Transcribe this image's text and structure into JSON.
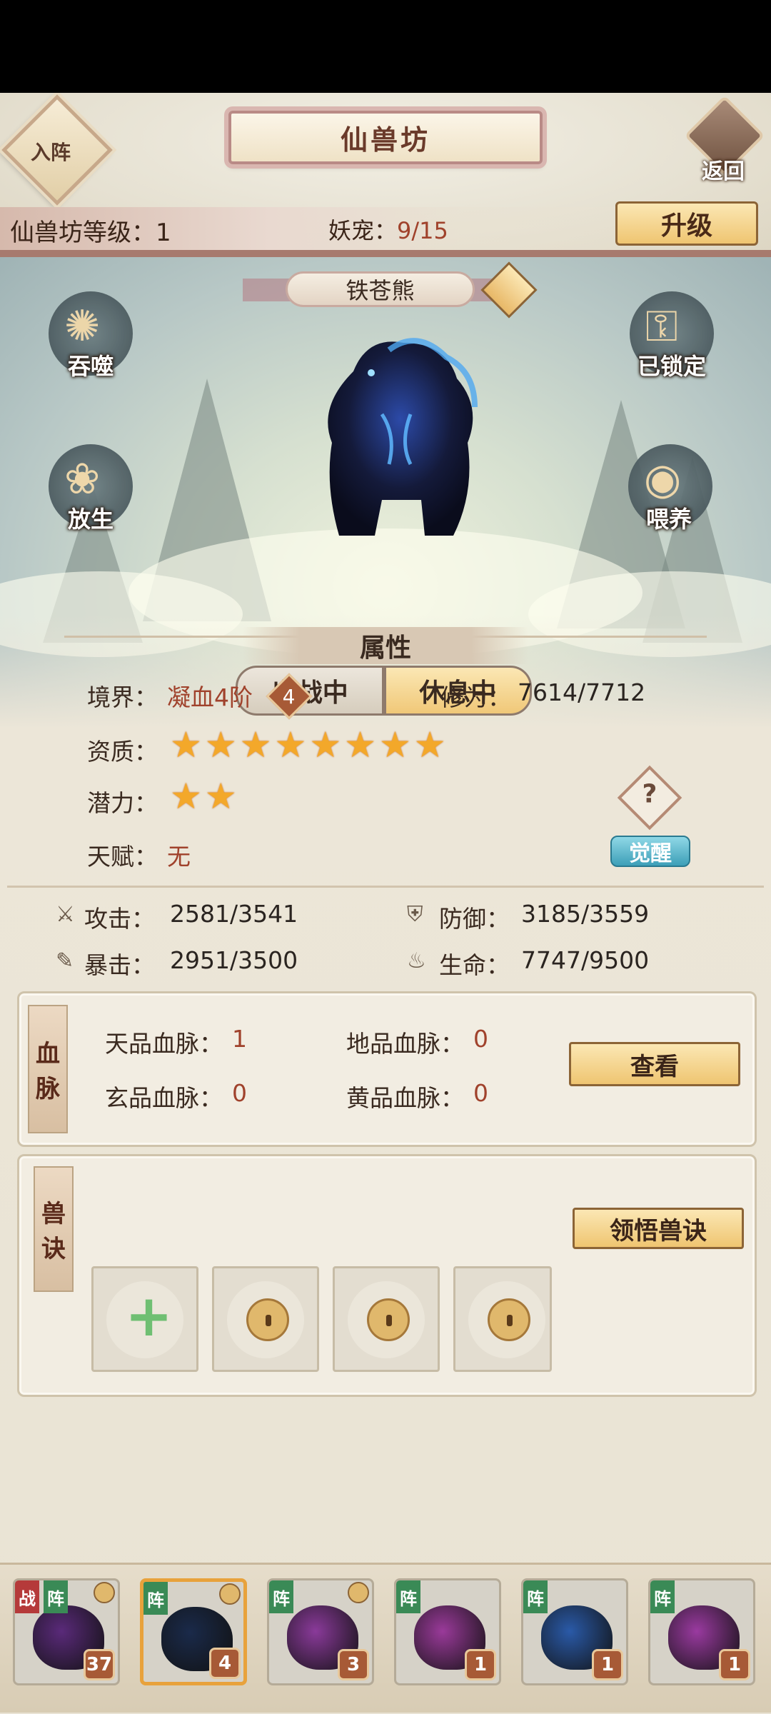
{
  "header": {
    "formation_label": "入阵",
    "title": "仙兽坊",
    "back_label": "返回",
    "level_label": "仙兽坊等级：",
    "level_value": "1",
    "pets_label": "妖宠：",
    "pets_value": "9/15",
    "upgrade_label": "升级"
  },
  "pet": {
    "name": "铁苍熊",
    "actions": {
      "devour": "吞噬",
      "locked": "已锁定",
      "release": "放生",
      "feed": "喂养"
    },
    "toggle": {
      "battle": "出战中",
      "rest": "休息中",
      "active": "rest"
    }
  },
  "attributes": {
    "section_title": "属性",
    "realm_label": "境界：",
    "realm_value": "凝血4阶",
    "realm_badge": "4",
    "cultivation_label": "修为：",
    "cultivation_value": "7614/7712",
    "aptitude_label": "资质：",
    "aptitude_stars": 8,
    "potential_label": "潜力：",
    "potential_stars": 2,
    "talent_label": "天赋：",
    "talent_value": "无",
    "help_icon": "?",
    "awaken_label": "觉醒"
  },
  "stats": {
    "attack_label": "攻击：",
    "attack_value": "2581/3541",
    "defense_label": "防御：",
    "defense_value": "3185/3559",
    "crit_label": "暴击：",
    "crit_value": "2951/3500",
    "hp_label": "生命：",
    "hp_value": "7747/9500"
  },
  "bloodline": {
    "tag_1": "血",
    "tag_2": "脉",
    "heaven_label": "天品血脉：",
    "heaven_value": "1",
    "earth_label": "地品血脉：",
    "earth_value": "0",
    "mystic_label": "玄品血脉：",
    "mystic_value": "0",
    "yellow_label": "黄品血脉：",
    "yellow_value": "0",
    "view_label": "查看"
  },
  "skills": {
    "tag_1": "兽",
    "tag_2": "诀",
    "learn_label": "领悟兽诀"
  },
  "roster": [
    {
      "battle_tag": "战",
      "formation_tag": "阵",
      "level": "37",
      "color": "#5a2a7a"
    },
    {
      "formation_tag": "阵",
      "level": "4",
      "color": "#1a2a4a",
      "selected": true
    },
    {
      "formation_tag": "阵",
      "level": "3",
      "color": "#8a3a9a"
    },
    {
      "formation_tag": "阵",
      "level": "1",
      "color": "#9a3a9a"
    },
    {
      "formation_tag": "阵",
      "level": "1",
      "color": "#2a5aa8"
    },
    {
      "formation_tag": "阵",
      "level": "1",
      "color": "#9a3aa0"
    }
  ],
  "colors": {
    "accent_red": "#a0422c",
    "star": "#f3a82a",
    "gold_button": "#efc571",
    "awaken": "#3d9fb8"
  }
}
